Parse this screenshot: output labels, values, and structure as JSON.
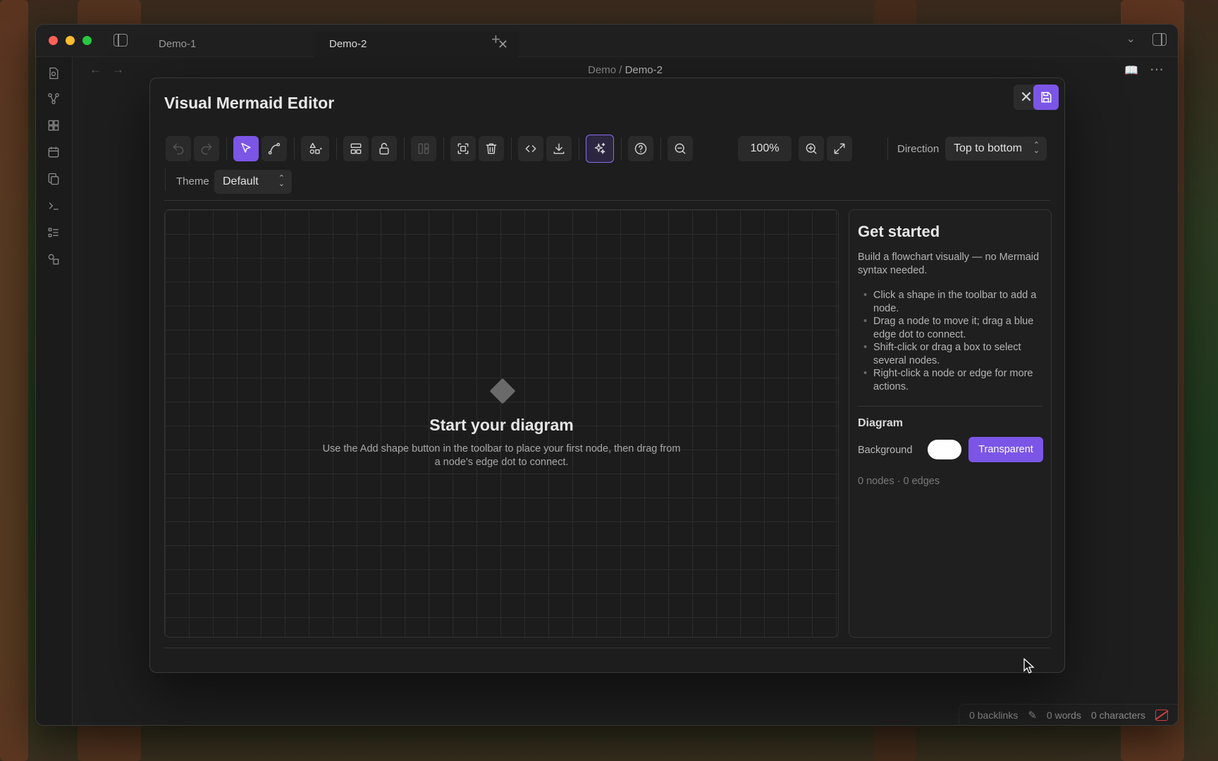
{
  "window": {
    "tabs": [
      {
        "label": "Demo-1"
      },
      {
        "label": "Demo-2"
      }
    ],
    "new_tab_glyph": "+",
    "tab_close_glyph": "✕"
  },
  "breadcrumb": {
    "folder": "Demo",
    "separator": "/",
    "current": "Demo-2"
  },
  "modal": {
    "title": "Visual Mermaid Editor",
    "close_glyph": "✕"
  },
  "toolbar": {
    "zoom": "100%",
    "direction_label": "Direction",
    "direction_value": "Top to bottom",
    "theme_label": "Theme",
    "theme_value": "Default",
    "icons": [
      "undo-icon",
      "redo-icon",
      "select-pointer-icon",
      "connect-edge-icon",
      "add-shape-icon",
      "layout-icon",
      "unlock-icon",
      "grid-layout-icon",
      "fit-view-icon",
      "trash-icon",
      "code-icon",
      "download-icon",
      "ai-sparkle-icon",
      "help-icon",
      "zoom-out-icon",
      "zoom-in-icon",
      "expand-icon"
    ]
  },
  "canvas": {
    "empty_title": "Start your diagram",
    "empty_desc": "Use the Add shape button in the toolbar to place your first node, then drag from a node's edge dot to connect."
  },
  "panel": {
    "title": "Get started",
    "intro": "Build a flowchart visually — no Mermaid syntax needed.",
    "tips": [
      "Click a shape in the toolbar to add a node.",
      "Drag a node to move it; drag a blue edge dot to connect.",
      "Shift-click or drag a box to select several nodes.",
      "Right-click a node or edge for more actions."
    ],
    "diagram_heading": "Diagram",
    "background_label": "Background",
    "background_color": "#ffffff",
    "transparent_button": "Transparent",
    "counts": "0 nodes · 0 edges"
  },
  "statusbar": {
    "backlinks": "0 backlinks",
    "words": "0 words",
    "characters": "0 characters"
  },
  "colors": {
    "accent": "#7b55e6",
    "window_bg": "#1e1e1e",
    "sync_error": "#d04040"
  }
}
